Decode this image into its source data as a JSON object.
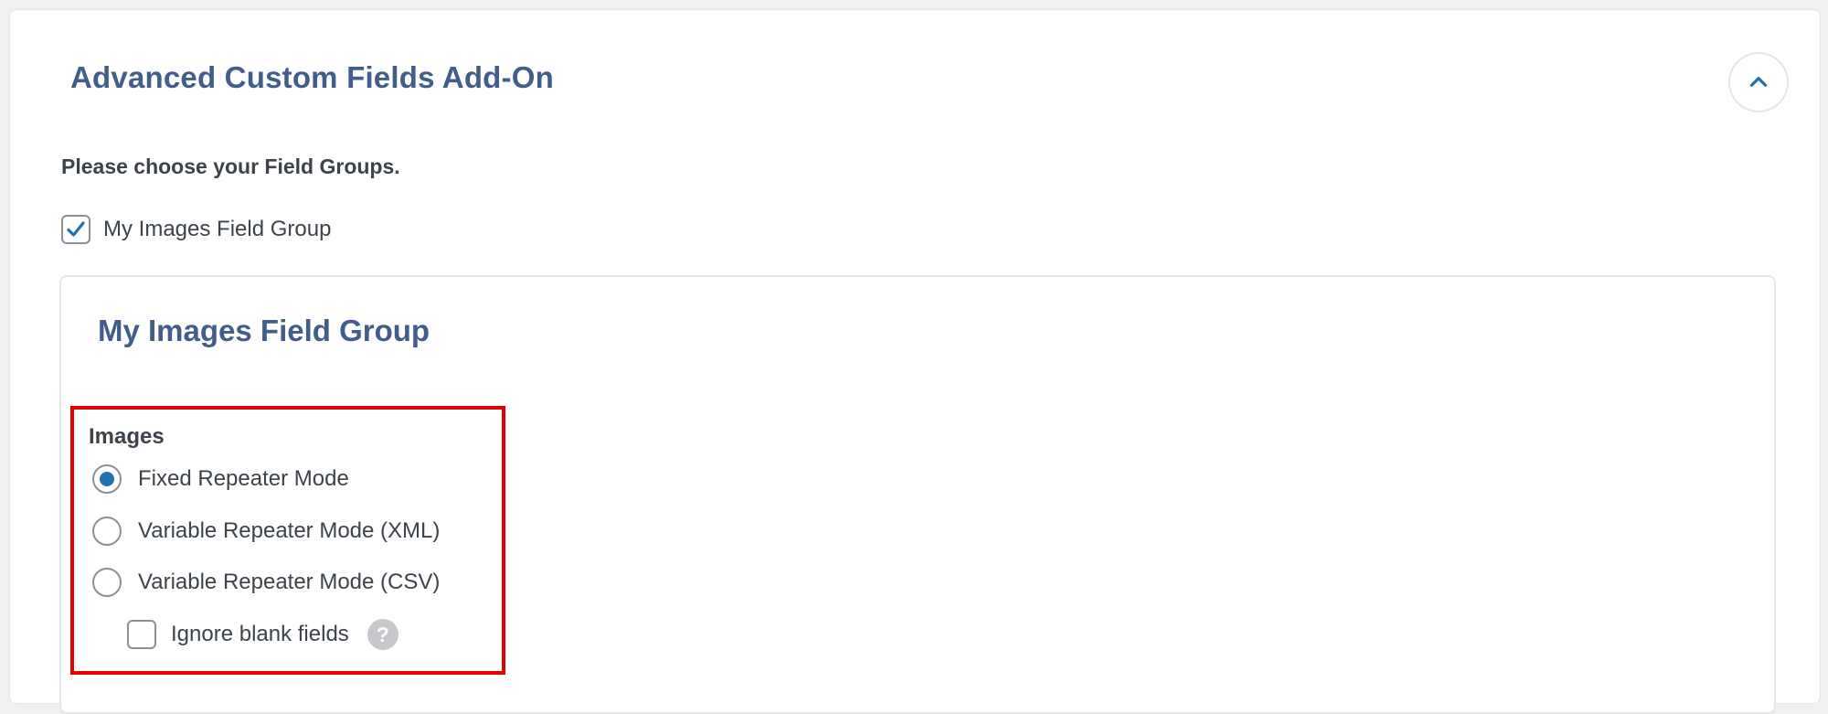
{
  "panel": {
    "title": "Advanced Custom Fields Add-On",
    "collapse_icon": "chevron-up-icon"
  },
  "intro": {
    "text": "Please choose your Field Groups."
  },
  "field_groups": [
    {
      "label": "My Images Field Group",
      "checked": true
    }
  ],
  "group_card": {
    "title": "My Images Field Group",
    "field": {
      "label": "Images",
      "modes": [
        {
          "label": "Fixed Repeater Mode",
          "selected": true
        },
        {
          "label": "Variable Repeater Mode (XML)",
          "selected": false
        },
        {
          "label": "Variable Repeater Mode (CSV)",
          "selected": false
        }
      ],
      "ignore_blank": {
        "label": "Ignore blank fields",
        "checked": false,
        "help_icon": "help-icon"
      }
    }
  },
  "colors": {
    "title": "#425d8c",
    "accent": "#2271b1",
    "highlight": "#e00000"
  }
}
